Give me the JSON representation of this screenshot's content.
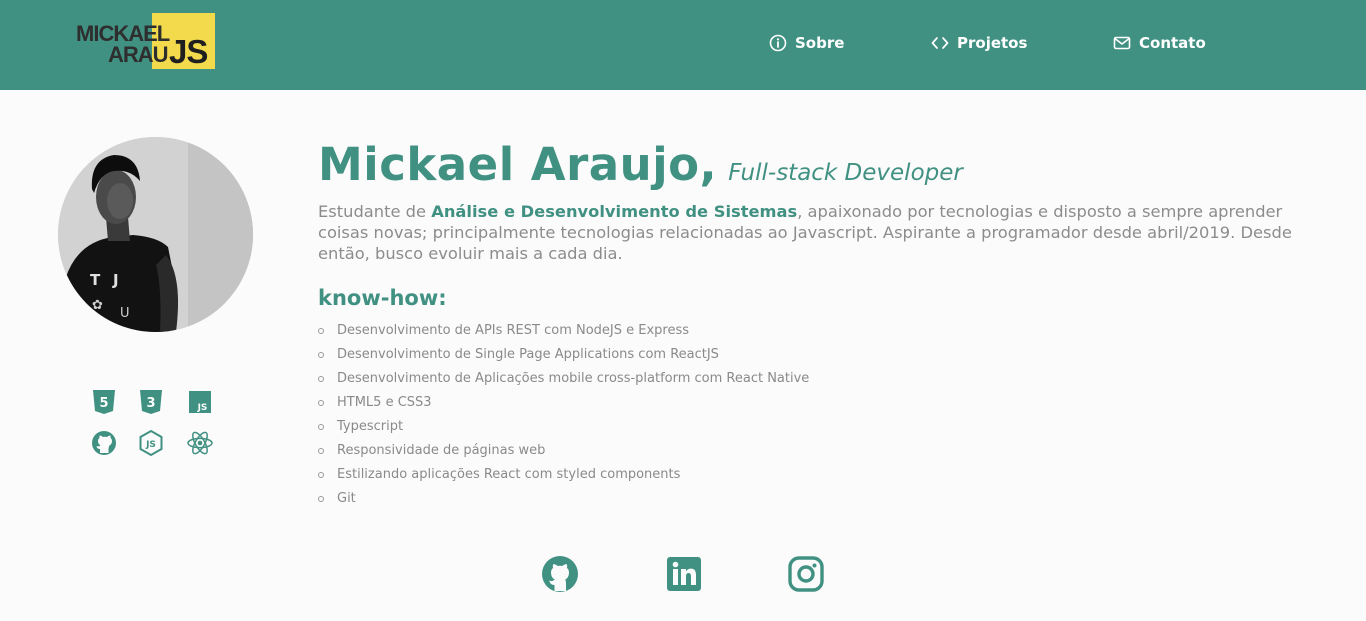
{
  "header": {
    "logo": {
      "line1": "MICKAEL",
      "line2": "ARAU",
      "accent": "JS"
    },
    "nav": [
      {
        "label": "Sobre",
        "icon": "info-icon"
      },
      {
        "label": "Projetos",
        "icon": "code-icon"
      },
      {
        "label": "Contato",
        "icon": "mail-icon"
      }
    ]
  },
  "profile": {
    "name": "Mickael Araujo,",
    "role": "Full-stack Developer",
    "bio": {
      "before": "Estudante de ",
      "highlight": "Análise e Desenvolvimento de Sistemas",
      "after": ", apaixonado por tecnologias e disposto a sempre aprender coisas novas; principalmente tecnologias relacionadas ao Javascript. Aspirante a programador desde abril/2019. Desde então, busco evoluir mais a cada dia."
    }
  },
  "knowhow": {
    "title": "know-how:",
    "items": [
      "Desenvolvimento de APIs REST com NodeJS e Express",
      "Desenvolvimento de Single Page Applications com ReactJS",
      "Desenvolvimento de Aplicações mobile cross-platform com React Native",
      "HTML5 e CSS3",
      "Typescript",
      "Responsividade de páginas web",
      "Estilizando aplicações React com styled components",
      "Git"
    ]
  },
  "tech_icons": [
    "html5-icon",
    "css3-icon",
    "javascript-icon",
    "github-icon",
    "nodejs-icon",
    "react-icon"
  ],
  "tech_icon_labels": {
    "html5": "5",
    "css3": "3",
    "js": "JS"
  },
  "social": [
    "github-icon",
    "linkedin-icon",
    "instagram-icon"
  ],
  "colors": {
    "primary": "#419183",
    "logo_yellow": "#f2da4c",
    "text_muted": "#8c8c8c"
  }
}
